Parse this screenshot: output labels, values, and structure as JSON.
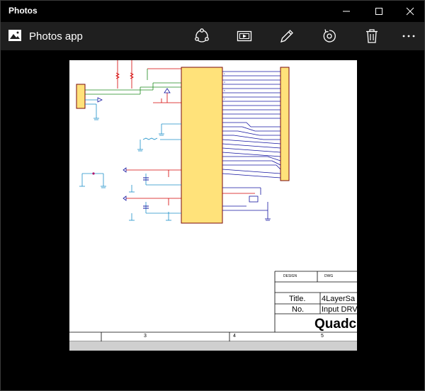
{
  "window": {
    "title": "Photos"
  },
  "appbar": {
    "app_name": "Photos app",
    "tools": [
      "share-icon",
      "slideshow-icon",
      "edit-icon",
      "rotate-icon",
      "delete-icon",
      "more-icon"
    ]
  },
  "document": {
    "title_block": {
      "designed_label": "DESIGN",
      "drawn_label": "DWG",
      "title_label": "Title.",
      "title_value": "4LayerSa",
      "no_label": "No.",
      "no_value": "Input DRV",
      "company": "Quadc"
    },
    "grid_numbers": [
      "3",
      "4",
      "5"
    ]
  },
  "colors": {
    "titlebar": "#000000",
    "appbar": "#1f1f1f",
    "chip": "#ffe27a",
    "wire_blue": "#1414a0",
    "wire_red": "#d40000",
    "wire_green": "#1c8a1c",
    "wire_cyan": "#1b8fc8"
  }
}
